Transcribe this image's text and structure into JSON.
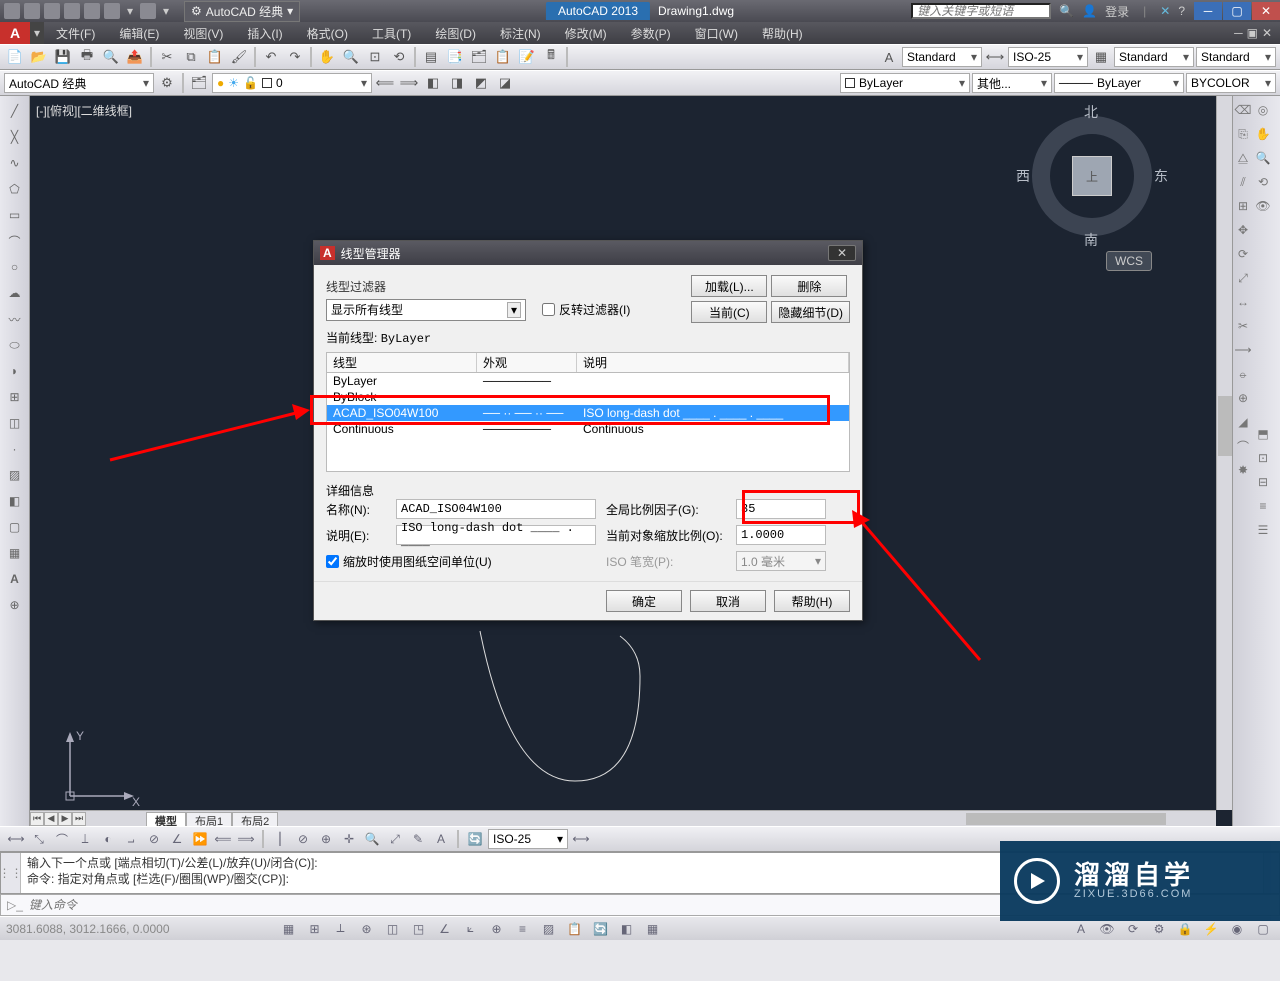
{
  "titlebar": {
    "workspace": "AutoCAD 经典",
    "app": "AutoCAD 2013",
    "file": "Drawing1.dwg",
    "search_ph": "键入关键字或短语",
    "login": "登录"
  },
  "menus": [
    "文件(F)",
    "编辑(E)",
    "视图(V)",
    "插入(I)",
    "格式(O)",
    "工具(T)",
    "绘图(D)",
    "标注(N)",
    "修改(M)",
    "参数(P)",
    "窗口(W)",
    "帮助(H)"
  ],
  "tb2": {
    "ws": "AutoCAD 经典",
    "layer0": "0",
    "standard": "Standard",
    "iso25": "ISO-25",
    "standard2": "Standard",
    "standard3": "Standard",
    "bylayer_lt": "ByLayer",
    "other": "其他...",
    "bylayer_lw": "ByLayer",
    "bycolor": "BYCOLOR"
  },
  "canvas": {
    "viewlabel": "[-][俯视][二维线框]",
    "n": "北",
    "s": "南",
    "e": "东",
    "w": "西",
    "top": "上",
    "wcs": "WCS",
    "tabs": [
      "模型",
      "布局1",
      "布局2"
    ]
  },
  "dlg": {
    "title": "线型管理器",
    "filter_legend": "线型过滤器",
    "show_all": "显示所有线型",
    "invert": "反转过滤器(I)",
    "load": "加载(L)...",
    "delete": "删除",
    "current_btn": "当前(C)",
    "hide_btn": "隐藏细节(D)",
    "current_lt": "当前线型:",
    "current_lt_val": "ByLayer",
    "col_lt": "线型",
    "col_look": "外观",
    "col_desc": "说明",
    "rows": [
      {
        "name": "ByLayer",
        "look": "────────",
        "desc": ""
      },
      {
        "name": "ByBlock",
        "look": "",
        "desc": ""
      },
      {
        "name": "ACAD_ISO04W100",
        "look": "── ·· ── ·· ──",
        "desc": "ISO long-dash dot ____ . ____ . ____"
      },
      {
        "name": "Continuous",
        "look": "────────",
        "desc": "Continuous"
      }
    ],
    "details_legend": "详细信息",
    "name_lbl": "名称(N):",
    "name_val": "ACAD_ISO04W100",
    "desc_lbl": "说明(E):",
    "desc_val": "ISO long-dash dot ____ . ____",
    "global_lbl": "全局比例因子(G):",
    "global_val": "35",
    "curobj_lbl": "当前对象缩放比例(O):",
    "curobj_val": "1.0000",
    "pen_lbl": "ISO 笔宽(P):",
    "pen_val": "1.0 毫米",
    "paper_chk": "缩放时使用图纸空间单位(U)",
    "ok": "确定",
    "cancel": "取消",
    "help": "帮助(H)"
  },
  "btoolbar": {
    "dimstyle": "ISO-25"
  },
  "cmd": {
    "line1": "输入下一个点或 [端点相切(T)/公差(L)/放弃(U)/闭合(C)]:",
    "line2": "命令: 指定对角点或 [栏选(F)/圈围(WP)/圈交(CP)]:",
    "ph": "键入命令"
  },
  "status": {
    "coords": "3081.6088, 3012.1666, 0.0000"
  },
  "wm": {
    "brand": "溜溜自学",
    "url": "ZIXUE.3D66.COM"
  }
}
